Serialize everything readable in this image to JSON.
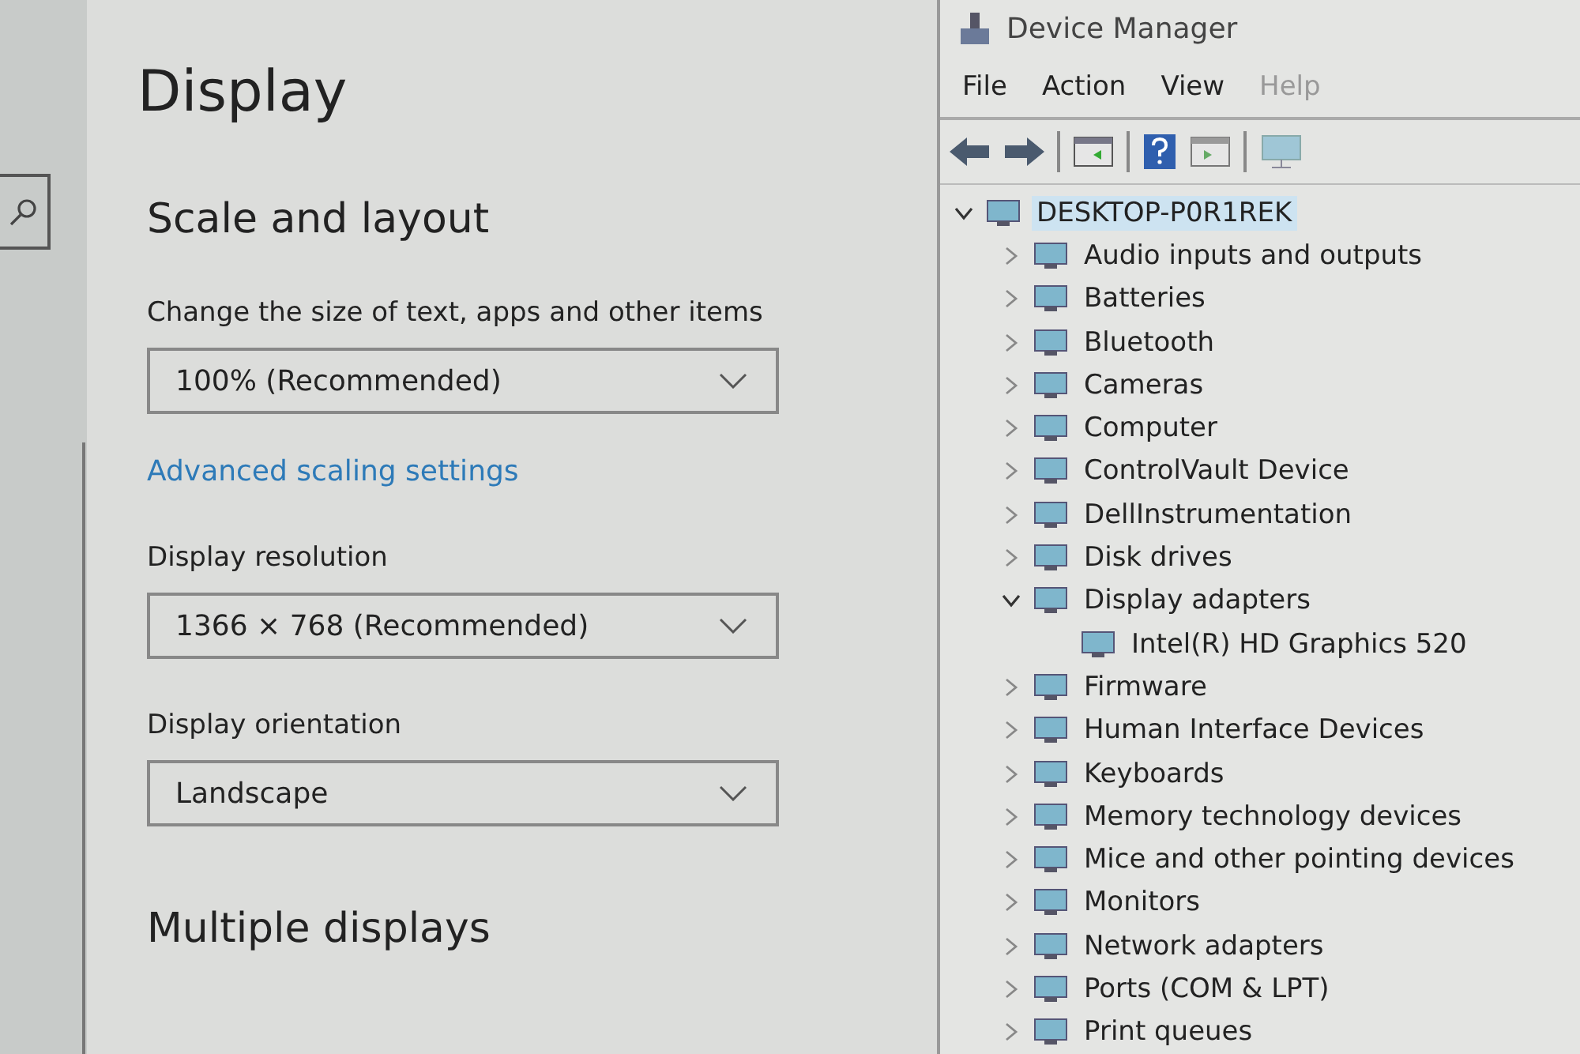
{
  "settings": {
    "title": "Display",
    "section_title": "Scale and layout",
    "scale_label": "Change the size of text, apps and other items",
    "scale_value": "100% (Recommended)",
    "advanced_link": "Advanced scaling settings",
    "resolution_label": "Display resolution",
    "resolution_value": "1366 × 768 (Recommended)",
    "orientation_label": "Display orientation",
    "orientation_value": "Landscape",
    "multiple_title": "Multiple displays"
  },
  "device_manager": {
    "title": "Device Manager",
    "menu": [
      {
        "label": "File",
        "disabled": false
      },
      {
        "label": "Action",
        "disabled": false
      },
      {
        "label": "View",
        "disabled": false
      },
      {
        "label": "Help",
        "disabled": true
      }
    ],
    "tree": [
      {
        "label": "DESKTOP-P0R1REK",
        "expanded": true,
        "selected": true,
        "children": [
          {
            "label": "Audio inputs and outputs",
            "expanded": false,
            "selected": false
          },
          {
            "label": "Batteries",
            "expanded": false,
            "selected": false
          },
          {
            "label": "Bluetooth",
            "expanded": false,
            "selected": false
          },
          {
            "label": "Cameras",
            "expanded": false,
            "selected": false
          },
          {
            "label": "Computer",
            "expanded": false,
            "selected": false
          },
          {
            "label": "ControlVault Device",
            "expanded": false,
            "selected": false
          },
          {
            "label": "DellInstrumentation",
            "expanded": false,
            "selected": false
          },
          {
            "label": "Disk drives",
            "expanded": false,
            "selected": false
          },
          {
            "label": "Display adapters",
            "expanded": true,
            "selected": false,
            "children": [
              {
                "label": "Intel(R) HD Graphics 520",
                "selected": false
              }
            ]
          },
          {
            "label": "Firmware",
            "expanded": false,
            "selected": false
          },
          {
            "label": "Human Interface Devices",
            "expanded": false,
            "selected": false
          },
          {
            "label": "Keyboards",
            "expanded": false,
            "selected": false
          },
          {
            "label": "Memory technology devices",
            "expanded": false,
            "selected": false
          },
          {
            "label": "Mice and other pointing devices",
            "expanded": false,
            "selected": false
          },
          {
            "label": "Monitors",
            "expanded": false,
            "selected": false
          },
          {
            "label": "Network adapters",
            "expanded": false,
            "selected": false
          },
          {
            "label": "Ports (COM & LPT)",
            "expanded": false,
            "selected": false
          },
          {
            "label": "Print queues",
            "expanded": false,
            "selected": false
          }
        ]
      }
    ]
  }
}
